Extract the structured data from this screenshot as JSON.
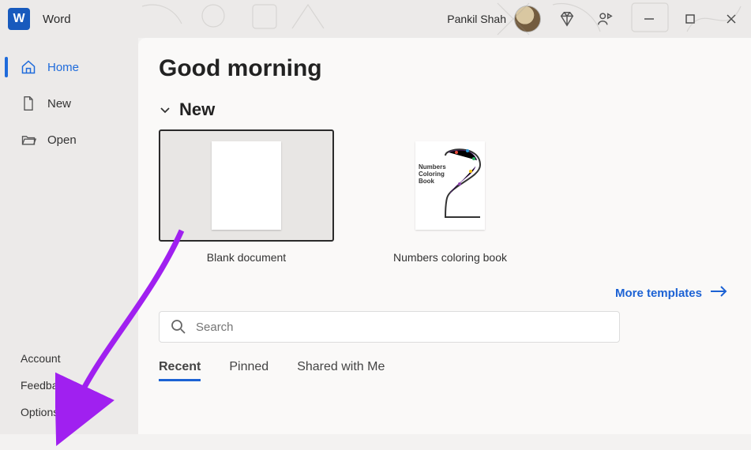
{
  "app": {
    "title": "Word",
    "icon_letter": "W"
  },
  "user": {
    "name": "Pankil Shah"
  },
  "window_controls": {
    "min": "—",
    "max": "□",
    "close": "✕"
  },
  "sidebar": {
    "items": [
      {
        "label": "Home",
        "icon": "home-icon",
        "active": true
      },
      {
        "label": "New",
        "icon": "new-icon",
        "active": false
      },
      {
        "label": "Open",
        "icon": "open-icon",
        "active": false
      }
    ],
    "bottom": [
      {
        "label": "Account"
      },
      {
        "label": "Feedback"
      },
      {
        "label": "Options"
      }
    ]
  },
  "content": {
    "greeting": "Good morning",
    "new_section": "New",
    "templates": [
      {
        "label": "Blank document"
      },
      {
        "label": "Numbers coloring book",
        "book_caption": "Numbers Coloring Book"
      }
    ],
    "more_templates": "More templates",
    "search": {
      "placeholder": "Search"
    },
    "tabs": [
      {
        "label": "Recent",
        "active": true
      },
      {
        "label": "Pinned",
        "active": false
      },
      {
        "label": "Shared with Me",
        "active": false
      }
    ]
  },
  "colors": {
    "accent": "#1c62d4",
    "word_brand": "#185abd",
    "annotation": "#a020f0"
  }
}
